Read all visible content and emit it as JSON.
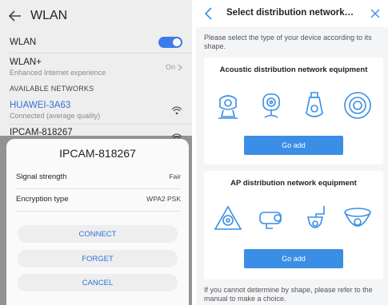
{
  "wlan_screen": {
    "title": "WLAN",
    "wlan_toggle_label": "WLAN",
    "wlan_plus": {
      "title": "WLAN+",
      "subtitle": "Enhanced Internet experience",
      "status": "On"
    },
    "section_header": "AVAILABLE NETWORKS",
    "networks": [
      {
        "name": "HUAWEI-3A63",
        "status": "Connected (average quality)"
      },
      {
        "name": "IPCAM-818267",
        "status": ""
      }
    ],
    "dialog": {
      "title": "IPCAM-818267",
      "rows": [
        {
          "label": "Signal strength",
          "value": "Fair"
        },
        {
          "label": "Encryption type",
          "value": "WPA2 PSK"
        }
      ],
      "buttons": {
        "connect": "CONNECT",
        "forget": "FORGET",
        "cancel": "CANCEL"
      }
    }
  },
  "distribution_screen": {
    "title": "Select distribution network t...",
    "intro": "Please select the type of your device according to its shape.",
    "cards": [
      {
        "title": "Acoustic distribution network equipment",
        "button": "Go add"
      },
      {
        "title": "AP distribution network equipment",
        "button": "Go add"
      }
    ],
    "footer": "If you cannot determine by shape, please refer to the manual to make a choice."
  },
  "colors": {
    "accent_blue": "#2d73d8",
    "button_blue": "#3a8ee6",
    "toggle_blue": "#3d7ce8"
  }
}
